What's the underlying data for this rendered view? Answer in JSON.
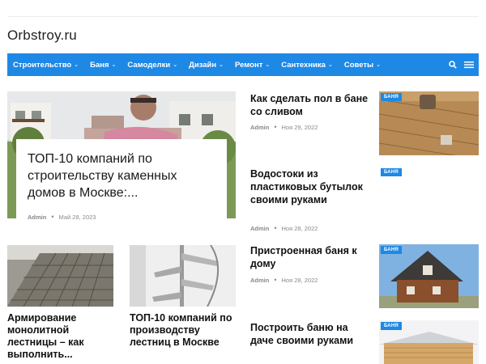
{
  "site": {
    "logo": "Orbstroy.ru"
  },
  "nav": {
    "items": [
      {
        "label": "Строительство"
      },
      {
        "label": "Баня"
      },
      {
        "label": "Самоделки"
      },
      {
        "label": "Дизайн"
      },
      {
        "label": "Ремонт"
      },
      {
        "label": "Сантехника"
      },
      {
        "label": "Советы"
      }
    ],
    "icons": [
      "search-icon",
      "menu-icon"
    ]
  },
  "featured": {
    "title": "ТОП-10 компаний по строительству каменных домов в Москве:...",
    "author": "Admin",
    "date": "Май 28, 2023"
  },
  "bottom_posts": [
    {
      "title": "Армирование монолитной лестницы – как выполнить..."
    },
    {
      "title": "ТОП-10 компаний по производству лестниц в Москве"
    }
  ],
  "side_posts": [
    {
      "title": "Как сделать пол в бане со сливом",
      "author": "Admin",
      "date": "Ноя 29, 2022",
      "badge": "БАНЯ"
    },
    {
      "title": "Водостоки из пластиковых бутылок своими руками",
      "author": "Admin",
      "date": "Ноя 28, 2022",
      "badge": "БАНЯ"
    },
    {
      "title": "Пристроенная баня к дому",
      "author": "Admin",
      "date": "Ноя 28, 2022",
      "badge": "БАНЯ"
    },
    {
      "title": "Построить баню на даче своими руками",
      "badge": "БАНЯ"
    }
  ],
  "colors": {
    "accent": "#1e88e5"
  }
}
